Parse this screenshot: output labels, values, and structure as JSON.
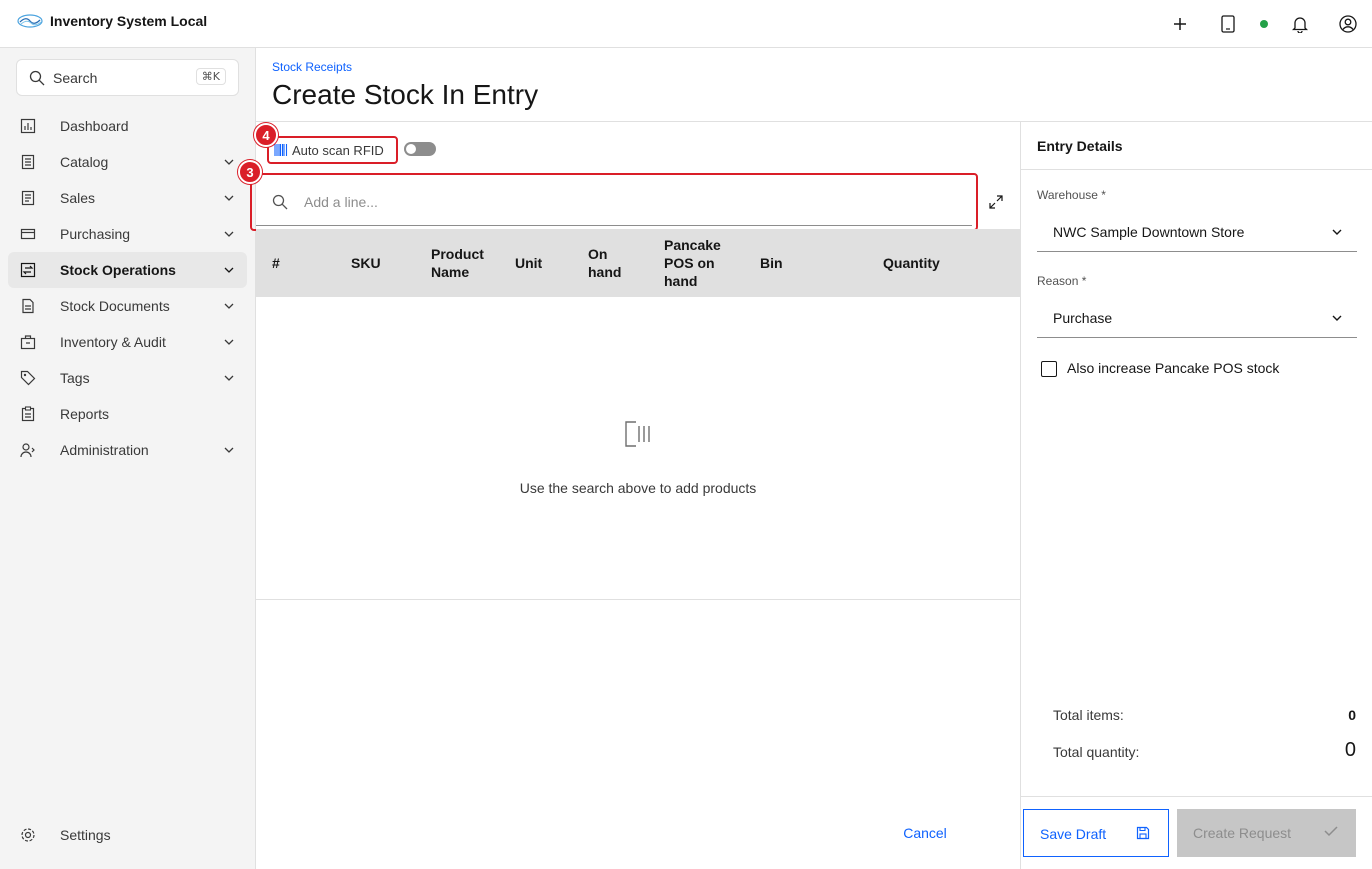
{
  "app": {
    "title": "Inventory System Local"
  },
  "header": {
    "icons": [
      "add-icon",
      "tablet-icon",
      "status-online-icon",
      "notification-icon",
      "user-avatar-icon"
    ],
    "status_color": "#24a148"
  },
  "sidebar": {
    "search_label": "Search",
    "search_shortcut": "⌘K",
    "items": [
      {
        "label": "Dashboard",
        "icon": "dashboard-icon",
        "expandable": false,
        "active": false
      },
      {
        "label": "Catalog",
        "icon": "catalog-icon",
        "expandable": true,
        "active": false
      },
      {
        "label": "Sales",
        "icon": "sales-icon",
        "expandable": true,
        "active": false
      },
      {
        "label": "Purchasing",
        "icon": "purchasing-icon",
        "expandable": true,
        "active": false
      },
      {
        "label": "Stock Operations",
        "icon": "stock-operations-icon",
        "expandable": true,
        "active": true
      },
      {
        "label": "Stock Documents",
        "icon": "document-icon",
        "expandable": true,
        "active": false
      },
      {
        "label": "Inventory & Audit",
        "icon": "inventory-icon",
        "expandable": true,
        "active": false
      },
      {
        "label": "Tags",
        "icon": "tag-icon",
        "expandable": true,
        "active": false
      },
      {
        "label": "Reports",
        "icon": "report-icon",
        "expandable": false,
        "active": false
      },
      {
        "label": "Administration",
        "icon": "admin-icon",
        "expandable": true,
        "active": false
      }
    ],
    "settings_label": "Settings"
  },
  "page": {
    "breadcrumb": "Stock Receipts",
    "title": "Create Stock In Entry"
  },
  "rfid": {
    "label": "Auto scan RFID",
    "enabled": false
  },
  "annotations": {
    "rfid_badge": "4",
    "search_badge": "3"
  },
  "line_search": {
    "placeholder": "Add a line...",
    "value": ""
  },
  "table": {
    "columns": [
      {
        "key": "index",
        "label": "#"
      },
      {
        "key": "sku",
        "label": "SKU"
      },
      {
        "key": "product_name",
        "label": "Product Name"
      },
      {
        "key": "unit",
        "label": "Unit"
      },
      {
        "key": "on_hand",
        "label": "On hand"
      },
      {
        "key": "pos_on_hand",
        "label": "Pancake POS on hand"
      },
      {
        "key": "bin",
        "label": "Bin"
      },
      {
        "key": "quantity",
        "label": "Quantity"
      }
    ],
    "rows": [],
    "empty_message": "Use the search above to add products"
  },
  "footer": {
    "cancel_label": "Cancel"
  },
  "entry_details": {
    "title": "Entry Details",
    "warehouse_label": "Warehouse *",
    "warehouse_value": "NWC Sample Downtown Store",
    "reason_label": "Reason *",
    "reason_value": "Purchase",
    "checkbox_label": "Also increase Pancake POS stock",
    "checkbox_checked": false,
    "total_items_label": "Total items:",
    "total_items_value": "0",
    "total_quantity_label": "Total quantity:",
    "total_quantity_value": "0",
    "save_draft_label": "Save Draft",
    "create_request_label": "Create Request"
  },
  "colors": {
    "accent": "#0f62fe",
    "annotation": "#da1e28",
    "disabled": "#c6c6c6"
  }
}
